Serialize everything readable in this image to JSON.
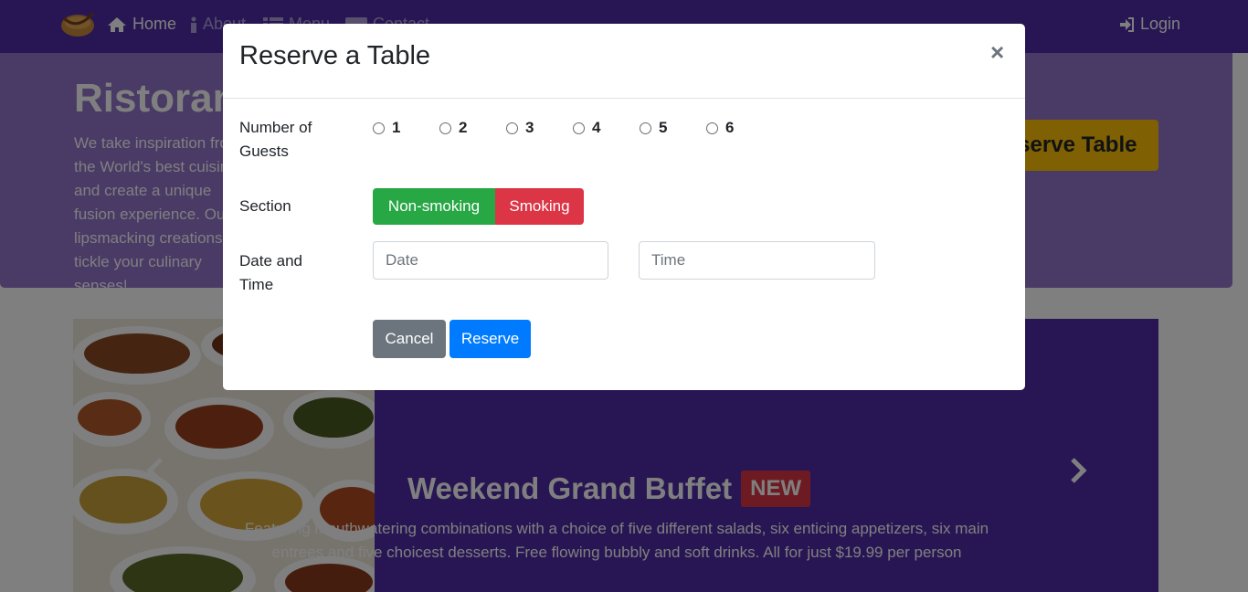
{
  "nav": {
    "home": "Home",
    "about": "About",
    "menu": "Menu",
    "contact": "Contact",
    "login": "Login"
  },
  "jumbotron": {
    "title": "Ristorante con Fusion",
    "text": "We take inspiration from the World's best cuisines, and create a unique fusion experience. Our lipsmacking creations will tickle your culinary senses!",
    "reserve_button": "Reserve Table"
  },
  "carousel": {
    "title": "Weekend Grand Buffet",
    "badge": "NEW",
    "caption": "Featuring mouthwatering combinations with a choice of five different salads, six enticing appetizers, six main entrees and five choicest desserts. Free flowing bubbly and soft drinks. All for just $19.99 per person"
  },
  "modal": {
    "title": "Reserve a Table",
    "close": "×",
    "guests_label": "Number of Guests",
    "guest_options": [
      "1",
      "2",
      "3",
      "4",
      "5",
      "6"
    ],
    "section_label": "Section",
    "section_nonsmoking": "Non-smoking",
    "section_smoking": "Smoking",
    "datetime_label": "Date and Time",
    "date_placeholder": "Date",
    "time_placeholder": "Time",
    "cancel": "Cancel",
    "reserve": "Reserve"
  },
  "colors": {
    "primary_dark": "#512da8",
    "primary_light": "#9575cd",
    "accent": "#ffc107",
    "success": "#28a745",
    "danger": "#dc3545",
    "secondary": "#6c757d",
    "blue": "#007bff"
  }
}
